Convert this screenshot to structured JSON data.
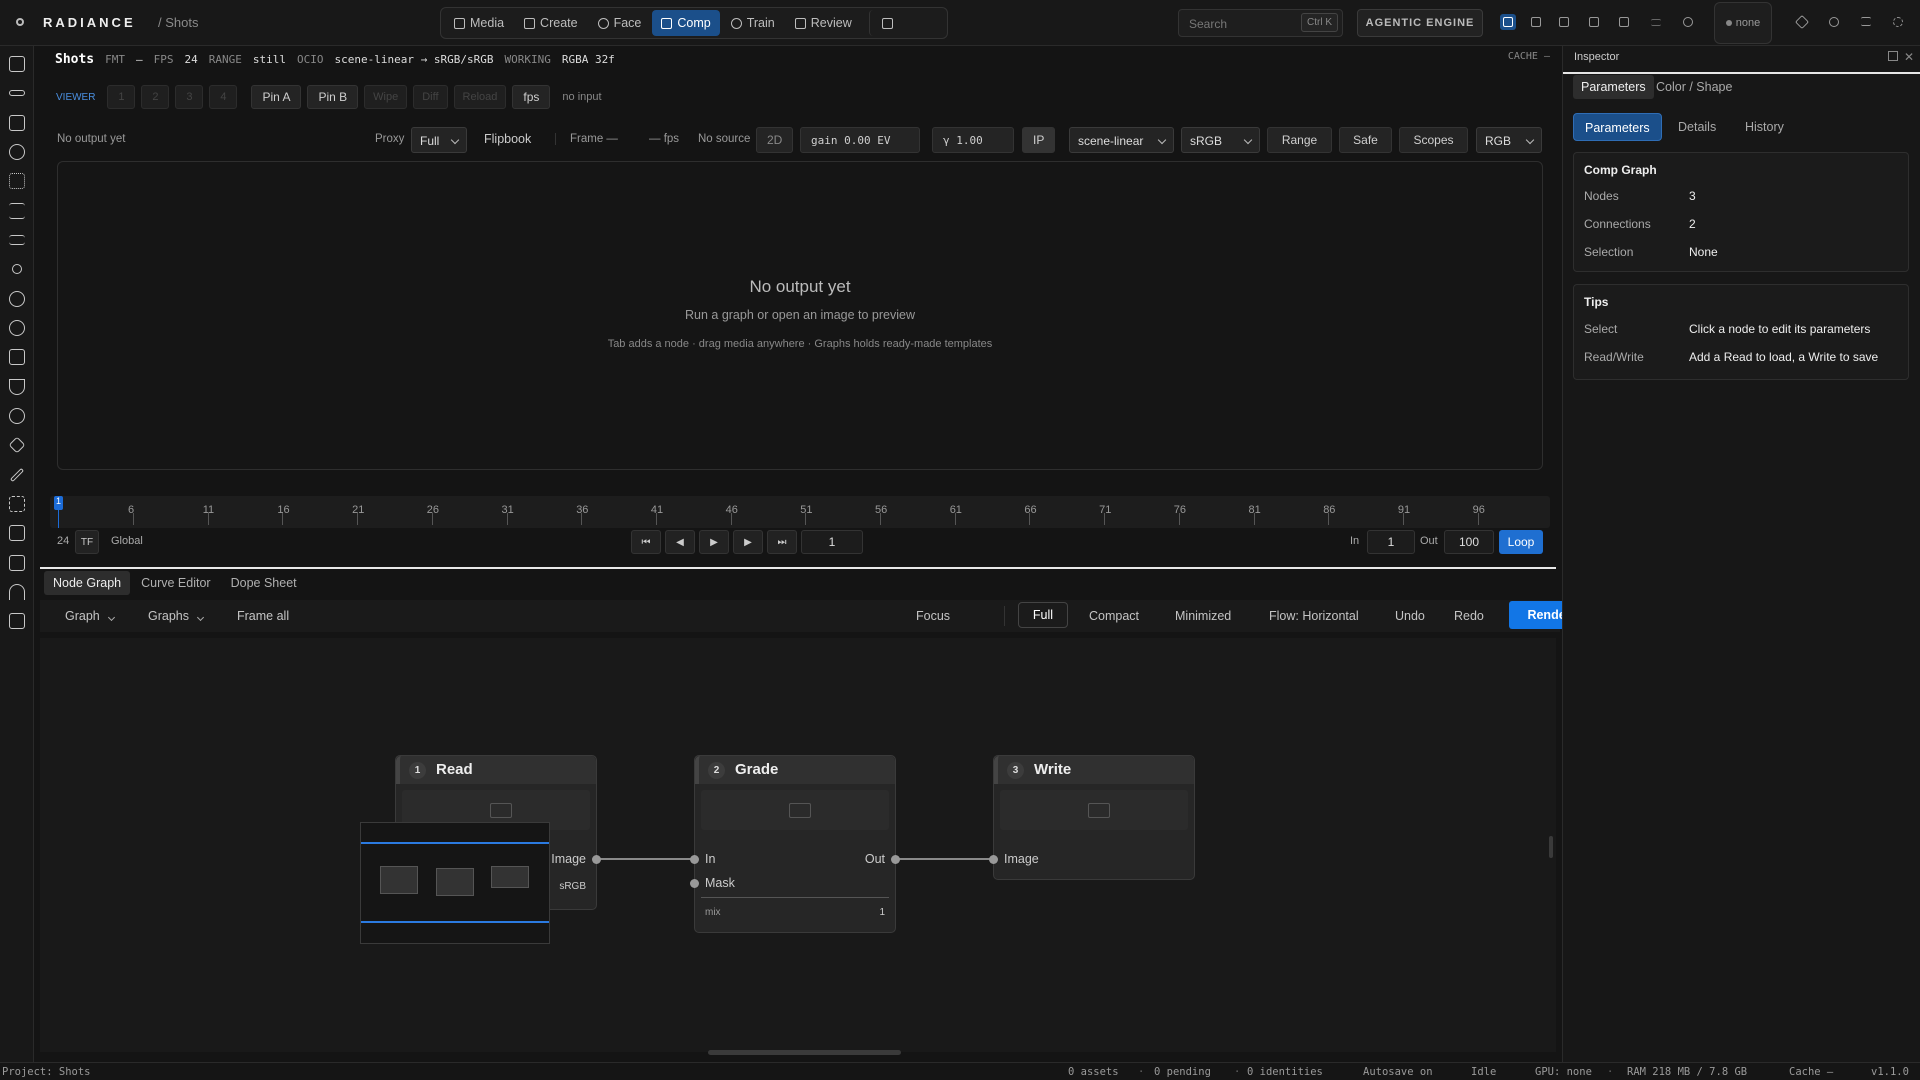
{
  "app": {
    "brand": "RADIANCE",
    "crumb": "/ Shots"
  },
  "nav": [
    {
      "label": "Media",
      "active": false
    },
    {
      "label": "Create",
      "active": false
    },
    {
      "label": "Face",
      "active": false
    },
    {
      "label": "Comp",
      "active": true
    },
    {
      "label": "Train",
      "active": false
    },
    {
      "label": "Review",
      "active": false
    }
  ],
  "search": {
    "placeholder": "Search",
    "shortcut": "Ctrl K"
  },
  "agentic_label": "AGENTIC ENGINE",
  "gpu_pill": "none",
  "shots": {
    "title": "Shots",
    "fmt_label": "FMT",
    "fmt_value": "—",
    "fps_label": "FPS",
    "fps_value": "24",
    "range_label": "RANGE",
    "range_value": "still",
    "ocio_label": "OCIO",
    "ocio_value": "scene-linear → sRGB/sRGB",
    "working_label": "WORKING",
    "working_value": "RGBA 32f",
    "cache_label": "CACHE —"
  },
  "viewer_bar": {
    "label": "VIEWER",
    "slots": [
      "1",
      "2",
      "3",
      "4"
    ],
    "pin_a": "Pin A",
    "pin_b": "Pin B",
    "wipe": "Wipe",
    "diff": "Diff",
    "reload": "Reload",
    "fps": "fps",
    "input": "no input"
  },
  "viewer_row": {
    "status": "No output yet",
    "proxy_label": "Proxy",
    "proxy_value": "Full",
    "flipbook": "Flipbook",
    "frame": "Frame —",
    "fps": "— fps",
    "source": "No source",
    "mode": "2D",
    "gain": "gain 0.00 EV",
    "gamma": "γ 1.00",
    "ip": "IP",
    "colorspace": "scene-linear",
    "display": "sRGB",
    "range": "Range",
    "safe": "Safe",
    "scopes": "Scopes",
    "channels": "RGB"
  },
  "canvas": {
    "title": "No output yet",
    "subtitle": "Run a graph or open an image to preview",
    "hint": "Tab adds a node · drag media anywhere · Graphs holds ready-made templates"
  },
  "timeline": {
    "ticks": [
      "6",
      "11",
      "16",
      "21",
      "26",
      "31",
      "36",
      "41",
      "46",
      "51",
      "56",
      "61",
      "66",
      "71",
      "76",
      "81",
      "86",
      "91",
      "96"
    ],
    "current": "1"
  },
  "transport": {
    "fps": "24",
    "tf": "TF",
    "scope": "Global",
    "frame": "1",
    "in_label": "In",
    "in_value": "1",
    "out_label": "Out",
    "out_value": "100",
    "loop": "Loop"
  },
  "tabs": [
    {
      "label": "Node Graph",
      "active": true
    },
    {
      "label": "Curve Editor",
      "active": false
    },
    {
      "label": "Dope Sheet",
      "active": false
    }
  ],
  "graph_toolbar": {
    "graph": "Graph",
    "graphs": "Graphs",
    "frame_all": "Frame all",
    "focus": "Focus",
    "full": "Full",
    "compact": "Compact",
    "minimized": "Minimized",
    "flow": "Flow: Horizontal",
    "undo": "Undo",
    "redo": "Redo",
    "render": "Render"
  },
  "nodes": [
    {
      "num": "1",
      "title": "Read",
      "output": "Image",
      "tag": "sRGB"
    },
    {
      "num": "2",
      "title": "Grade",
      "input1": "In",
      "input2": "Mask",
      "output": "Out",
      "param": "mix",
      "param_value": "1"
    },
    {
      "num": "3",
      "title": "Write",
      "input": "Image"
    }
  ],
  "inspector": {
    "title": "Inspector",
    "top_tabs": [
      "Parameters",
      "Color / Shape"
    ],
    "sub_tabs": [
      "Parameters",
      "Details",
      "History"
    ],
    "comp_graph": {
      "heading": "Comp Graph",
      "rows": [
        {
          "k": "Nodes",
          "v": "3"
        },
        {
          "k": "Connections",
          "v": "2"
        },
        {
          "k": "Selection",
          "v": "None"
        }
      ]
    },
    "tips": {
      "heading": "Tips",
      "rows": [
        {
          "k": "Select",
          "v": "Click a node to edit its parameters"
        },
        {
          "k": "Read/Write",
          "v": "Add a Read to load, a Write to save"
        }
      ]
    }
  },
  "status": {
    "project": "Project: Shots",
    "assets": "0 assets",
    "pending": "0 pending",
    "identities": "0 identities",
    "autosave": "Autosave on",
    "state": "Idle",
    "gpu": "GPU: none",
    "ram": "RAM 218 MB / 7.8 GB",
    "cache": "Cache —",
    "version": "v1.1.0"
  },
  "colors": {
    "accent": "#1276e6",
    "active_nav": "#1b4f8a",
    "bg": "#141414"
  }
}
